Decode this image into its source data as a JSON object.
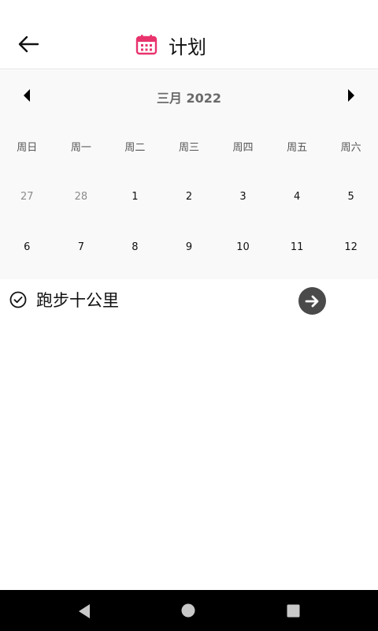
{
  "app_bar": {
    "title": "计划",
    "back_icon": "arrow-left-icon",
    "title_icon": "calendar-icon",
    "accent_color": "#e8336d"
  },
  "calendar": {
    "month_label": "三月 2022",
    "prev_icon": "triangle-left-icon",
    "next_icon": "triangle-right-icon",
    "weekdays": [
      "周日",
      "周一",
      "周二",
      "周三",
      "周四",
      "周五",
      "周六"
    ],
    "weeks": [
      [
        {
          "label": "27",
          "muted": true
        },
        {
          "label": "28",
          "muted": true
        },
        {
          "label": "1",
          "muted": false
        },
        {
          "label": "2",
          "muted": false
        },
        {
          "label": "3",
          "muted": false
        },
        {
          "label": "4",
          "muted": false
        },
        {
          "label": "5",
          "muted": false
        }
      ],
      [
        {
          "label": "6",
          "muted": false
        },
        {
          "label": "7",
          "muted": false
        },
        {
          "label": "8",
          "muted": false
        },
        {
          "label": "9",
          "muted": false
        },
        {
          "label": "10",
          "muted": false
        },
        {
          "label": "11",
          "muted": false
        },
        {
          "label": "12",
          "muted": false
        }
      ]
    ]
  },
  "tasks": [
    {
      "text": "跑步十公里",
      "status_icon": "check-circle-icon",
      "action_icon": "arrow-right-circle-icon"
    }
  ],
  "system_nav": {
    "back_icon": "nav-back-triangle-icon",
    "home_icon": "nav-home-circle-icon",
    "recent_icon": "nav-recent-square-icon"
  }
}
